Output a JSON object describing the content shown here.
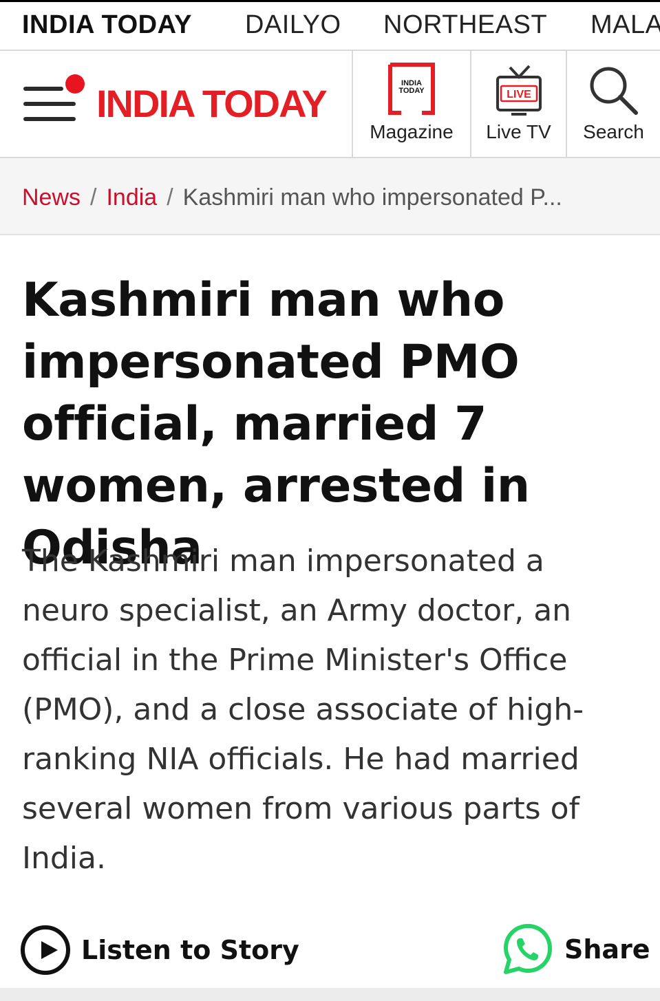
{
  "top_nav": {
    "items": [
      {
        "label": "INDIA TODAY",
        "active": true
      },
      {
        "label": "DAILYO",
        "active": false
      },
      {
        "label": "NORTHEAST",
        "active": false
      },
      {
        "label": "MALAYALAM",
        "active": false
      }
    ]
  },
  "header": {
    "logo_text": "INDIA TODAY",
    "brand_color": "#e31e24",
    "menu_icon": "hamburger-menu-icon",
    "magazine": {
      "label": "Magazine",
      "icon_text_top": "INDIA",
      "icon_text_bottom": "TODAY"
    },
    "live_tv": {
      "label": "Live TV",
      "icon_badge": "LIVE"
    },
    "search": {
      "label": "Search"
    }
  },
  "breadcrumb": {
    "items": [
      {
        "label": "News"
      },
      {
        "label": "India"
      }
    ],
    "current": "Kashmiri man who impersonated P..."
  },
  "article": {
    "headline": "Kashmiri man who impersonated PMO official, married 7 women, arrested in Odisha",
    "summary": "The Kashmiri man impersonated a neuro specialist, an Army doctor, an official in the Prime Minister's Office (PMO), and a close associate of high-ranking NIA officials. He had married several women from various parts of India."
  },
  "actions": {
    "listen_label": "Listen to Story",
    "share_label": "Share",
    "share_icon": "whatsapp-icon",
    "whatsapp_color": "#25d366"
  }
}
